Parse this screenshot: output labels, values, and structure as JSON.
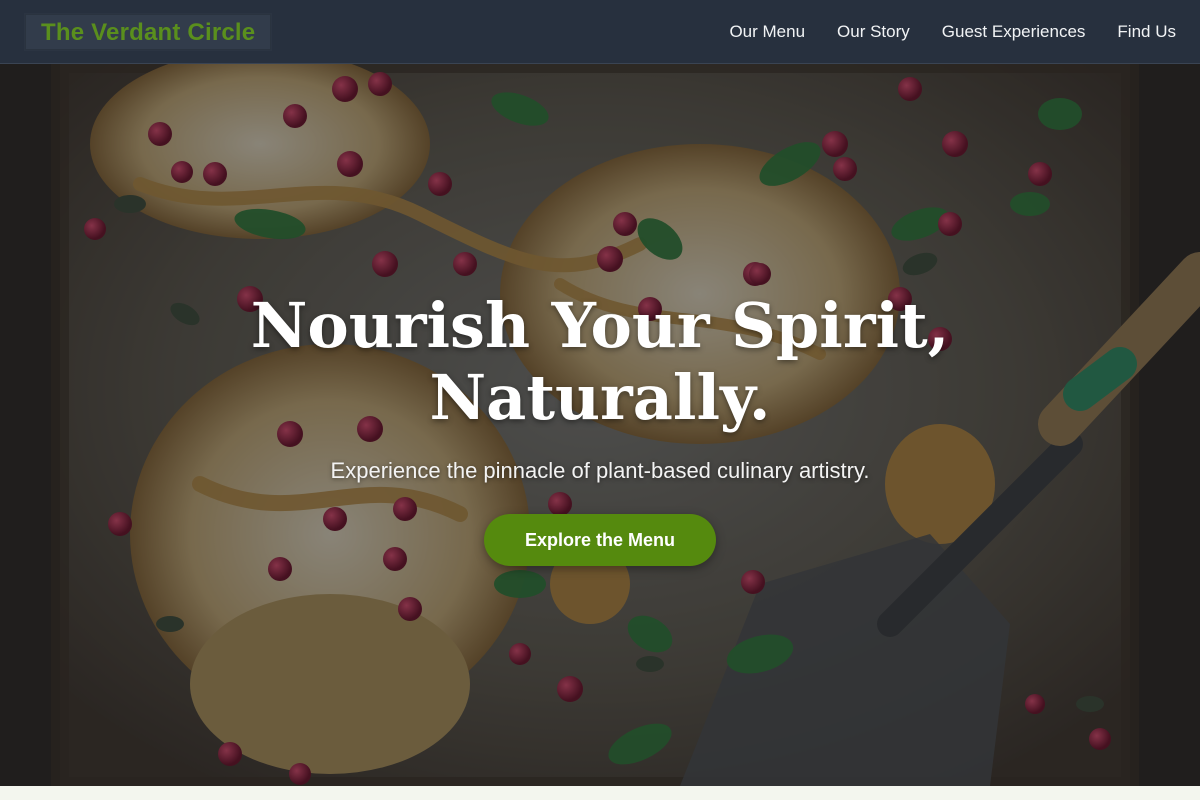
{
  "brand": {
    "name": "The Verdant Circle",
    "color": "#5a8f1d"
  },
  "nav": {
    "items": [
      {
        "label": "Our Menu"
      },
      {
        "label": "Our Story"
      },
      {
        "label": "Guest Experiences"
      },
      {
        "label": "Find Us"
      }
    ]
  },
  "hero": {
    "title": "Nourish Your Spirit, Naturally.",
    "subtitle": "Experience the pinnacle of plant-based culinary artistry.",
    "cta_label": "Explore the Menu",
    "cta_color": "#558a0e"
  },
  "colors": {
    "navbar_bg": "#27303e",
    "page_bg": "#f3f6ee"
  }
}
